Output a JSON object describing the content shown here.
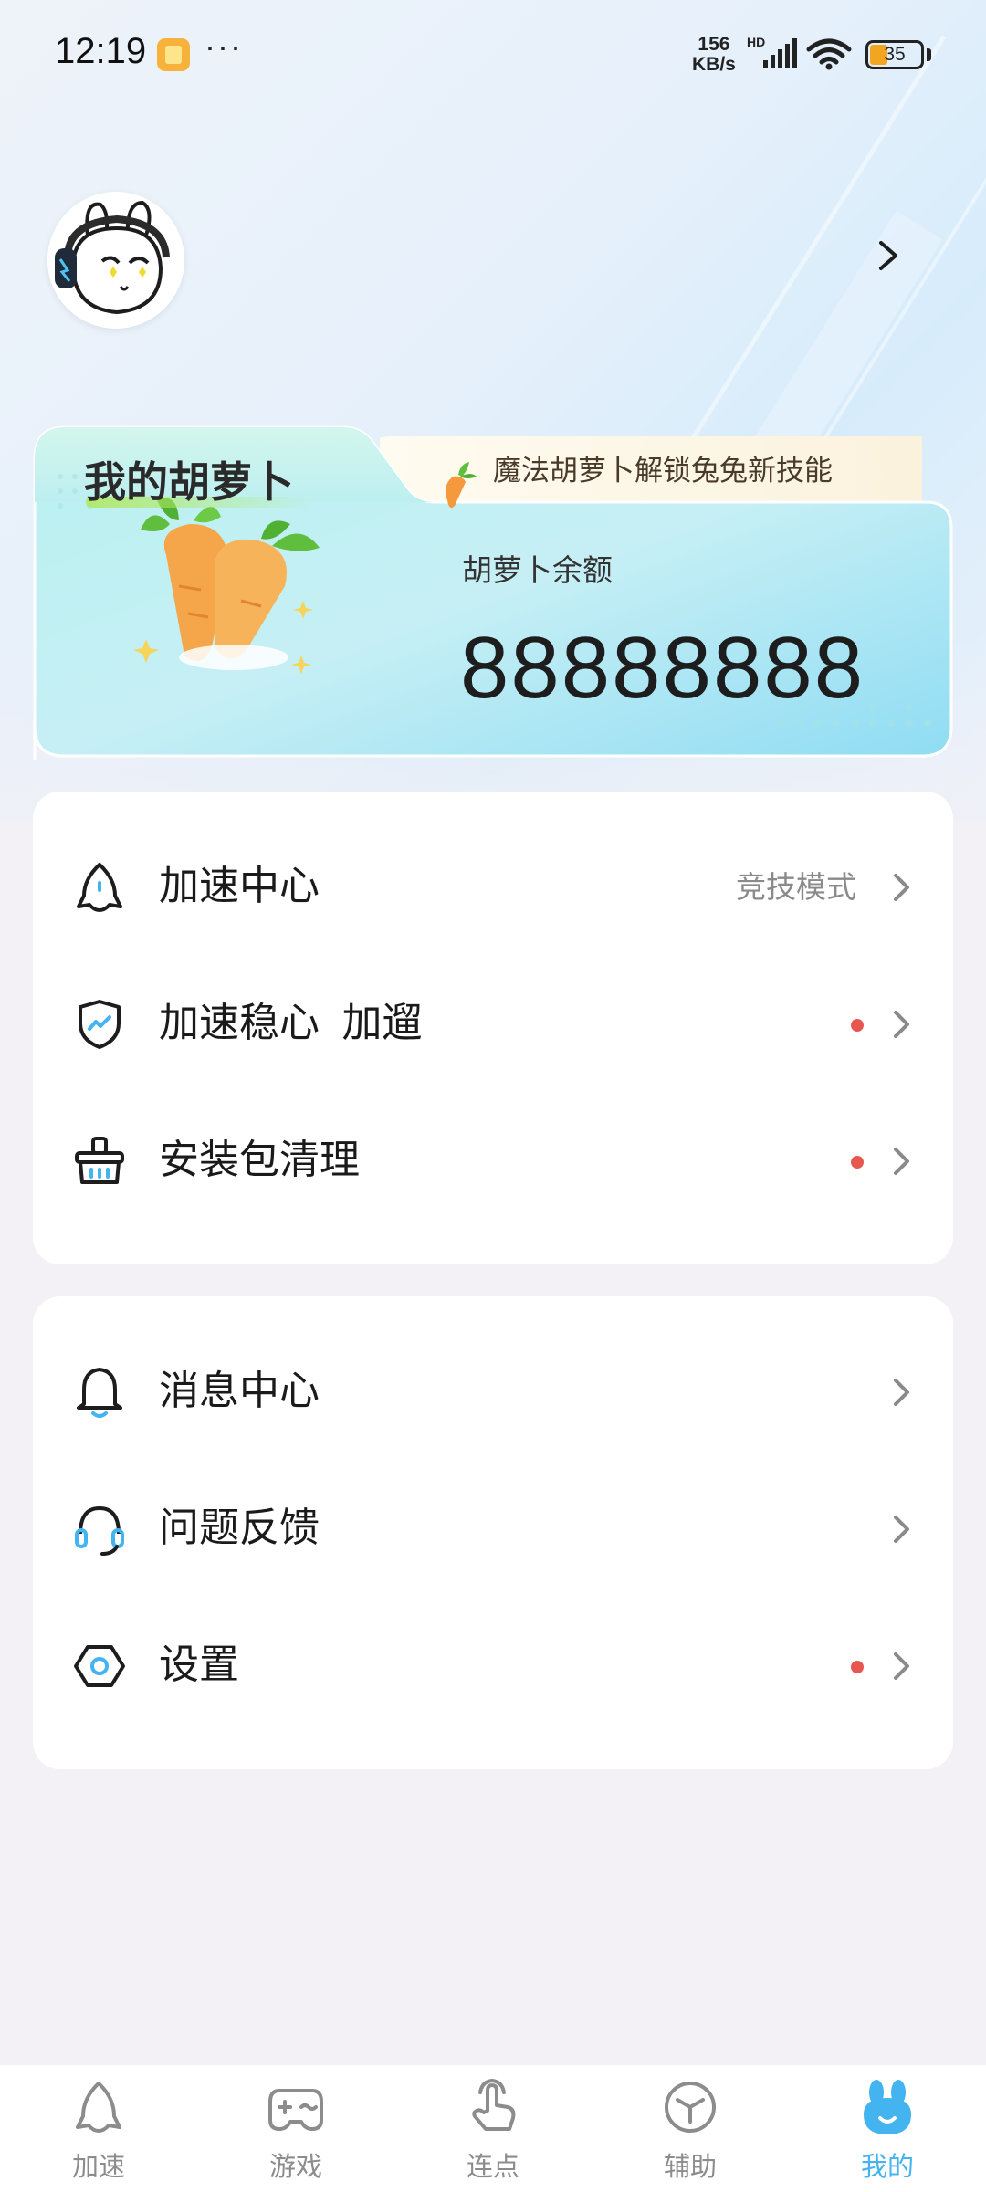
{
  "status_bar": {
    "time": "12:19",
    "more": "···",
    "net_speed_value": "156",
    "net_speed_unit": "KB/s",
    "network_type": "HD",
    "battery_level": "35",
    "battery_fraction": 0.35
  },
  "colors": {
    "accent": "#43b4ef",
    "red_dot": "#e8574f",
    "card_teal": "#9fe3ef",
    "banner_bg": "#fbf4e4"
  },
  "profile": {
    "avatar_icon": "rabbit-avatar-icon",
    "arrow_icon": "chevron-right-icon"
  },
  "carrot_card": {
    "title": "我的胡萝卜",
    "banner_text": "魔法胡萝卜解锁兔兔新技能",
    "balance_label": "胡萝卜余额",
    "balance_value": "88888888"
  },
  "menu_group_1": {
    "items": [
      {
        "label": "加速中心",
        "value": "竞技模式",
        "icon": "rocket-icon",
        "dot": false
      },
      {
        "label": "加速稳心  加遛",
        "value": "",
        "icon": "shield-icon",
        "dot": true
      },
      {
        "label": "安装包清理",
        "value": "",
        "icon": "basket-icon",
        "dot": true
      }
    ]
  },
  "menu_group_2": {
    "items": [
      {
        "label": "消息中心",
        "value": "",
        "icon": "bell-icon",
        "dot": false
      },
      {
        "label": "问题反馈",
        "value": "",
        "icon": "headset-icon",
        "dot": false
      },
      {
        "label": "设置",
        "value": "",
        "icon": "settings-hexagon-icon",
        "dot": true
      }
    ]
  },
  "bottom_nav": {
    "items": [
      {
        "label": "加速",
        "icon": "rocket-icon",
        "active": false
      },
      {
        "label": "游戏",
        "icon": "gamepad-icon",
        "active": false
      },
      {
        "label": "连点",
        "icon": "tap-finger-icon",
        "active": false
      },
      {
        "label": "辅助",
        "icon": "cube-icon",
        "active": false
      },
      {
        "label": "我的",
        "icon": "rabbit-icon",
        "active": true
      }
    ]
  }
}
